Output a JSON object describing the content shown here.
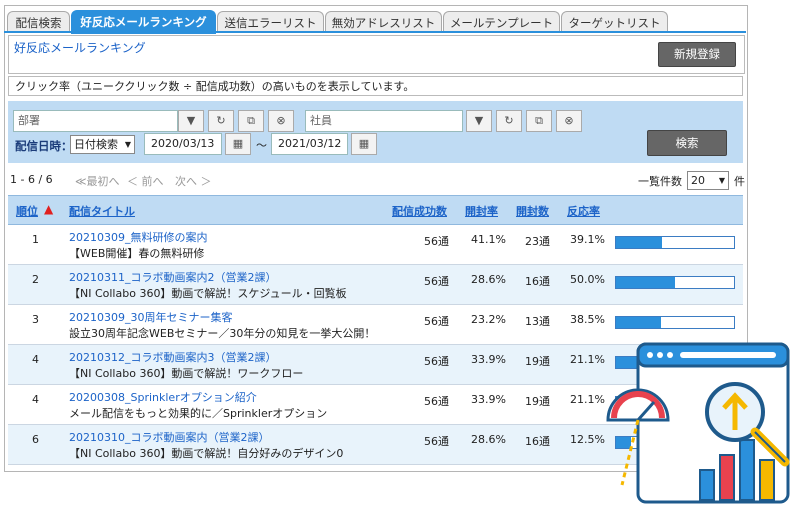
{
  "tabs": [
    {
      "label": "配信検索"
    },
    {
      "label": "好反応メールランキング"
    },
    {
      "label": "送信エラーリスト"
    },
    {
      "label": "無効アドレスリスト"
    },
    {
      "label": "メールテンプレート"
    },
    {
      "label": "ターゲットリスト"
    }
  ],
  "page": {
    "title": "好反応メールランキング",
    "new_button": "新規登録",
    "description": "クリック率（ユニーククリック数 ÷ 配信成功数）の高いものを表示しています。"
  },
  "filter": {
    "department_placeholder": "部署",
    "employee_placeholder": "社員",
    "date_label": "配信日時：",
    "date_mode": "日付検索",
    "date_from": "2020/03/13",
    "date_sep": "～",
    "date_to": "2021/03/12",
    "search_button": "検索"
  },
  "pager": {
    "range": "1 - 6 / 6",
    "first": "≪最初へ",
    "prev": "＜ 前へ",
    "next": "次へ ＞",
    "per_page_label": "一覧件数",
    "per_page": "20",
    "per_page_unit": "件"
  },
  "table": {
    "headers": {
      "rank": "順位",
      "title": "配信タイトル",
      "success": "配信成功数",
      "open_rate": "開封率",
      "opens": "開封数",
      "response_rate": "反応率"
    },
    "rows": [
      {
        "rank": "1",
        "title": "20210309_無料研修の案内",
        "subtitle": "【WEB開催】春の無料研修",
        "success": "56通",
        "open_rate": "41.1%",
        "opens": "23通",
        "response_rate": "39.1%",
        "response": 0.391
      },
      {
        "rank": "2",
        "title": "20210311_コラボ動画案内2（営業2課）",
        "subtitle": "【NI Collabo 360】動画で解説！スケジュール・回覧板",
        "success": "56通",
        "open_rate": "28.6%",
        "opens": "16通",
        "response_rate": "50.0%",
        "response": 0.5
      },
      {
        "rank": "3",
        "title": "20210309_30周年セミナー集客",
        "subtitle": "設立30周年記念WEBセミナー／30年分の知見を一挙大公開！",
        "success": "56通",
        "open_rate": "23.2%",
        "opens": "13通",
        "response_rate": "38.5%",
        "response": 0.385
      },
      {
        "rank": "4",
        "title": "20210312_コラボ動画案内3（営業2課）",
        "subtitle": "【NI Collabo 360】動画で解説！ワークフロー",
        "success": "56通",
        "open_rate": "33.9%",
        "opens": "19通",
        "response_rate": "21.1%",
        "response": 0.211
      },
      {
        "rank": "4",
        "title": "20200308_Sprinklerオプション紹介",
        "subtitle": "メール配信をもっと効果的に／Sprinklerオプション",
        "success": "56通",
        "open_rate": "33.9%",
        "opens": "19通",
        "response_rate": "21.1%",
        "response": 0.211
      },
      {
        "rank": "6",
        "title": "20210310_コラボ動画案内（営業2課）",
        "subtitle": "【NI Collabo 360】動画で解説！自分好みのデザイン0",
        "success": "56通",
        "open_rate": "28.6%",
        "opens": "16通",
        "response_rate": "12.5%",
        "response": 0.125
      }
    ]
  },
  "colors": {
    "accent": "#2b90dc",
    "header_bg": "#bfdbf3",
    "link": "#1c63c8"
  }
}
